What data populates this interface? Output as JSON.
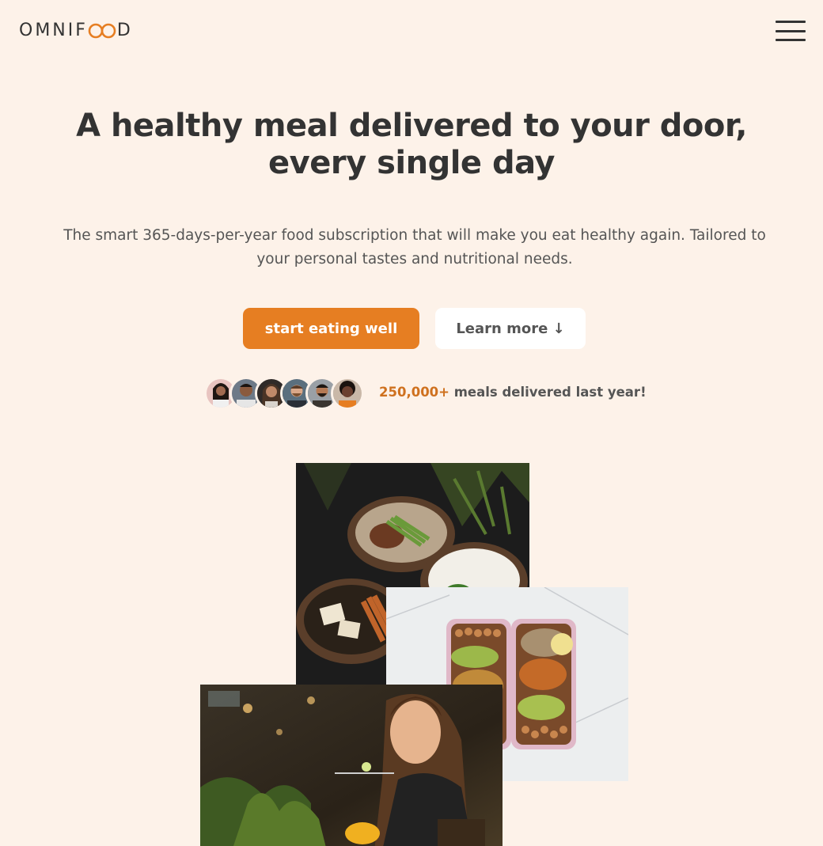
{
  "header": {
    "logo_before": "OMNIF",
    "logo_after": "D",
    "logo_full": "OMNIFOOD",
    "accent_color": "#e67e22",
    "menu_icon": "hamburger-menu-icon"
  },
  "hero": {
    "title_line1": "A healthy meal delivered to your door,",
    "title_line2": "every single day",
    "description": "The smart 365-days-per-year food subscription that will make you eat healthy again. Tailored to your personal tastes and nutritional needs.",
    "cta_primary": "start eating well",
    "cta_secondary": "Learn more ↓"
  },
  "delivered": {
    "number": "250,000+",
    "text": " meals delivered last year!",
    "customer_avatars": 6
  },
  "colors": {
    "background": "#fdf2e9",
    "primary": "#e67e22",
    "text": "#333333"
  }
}
